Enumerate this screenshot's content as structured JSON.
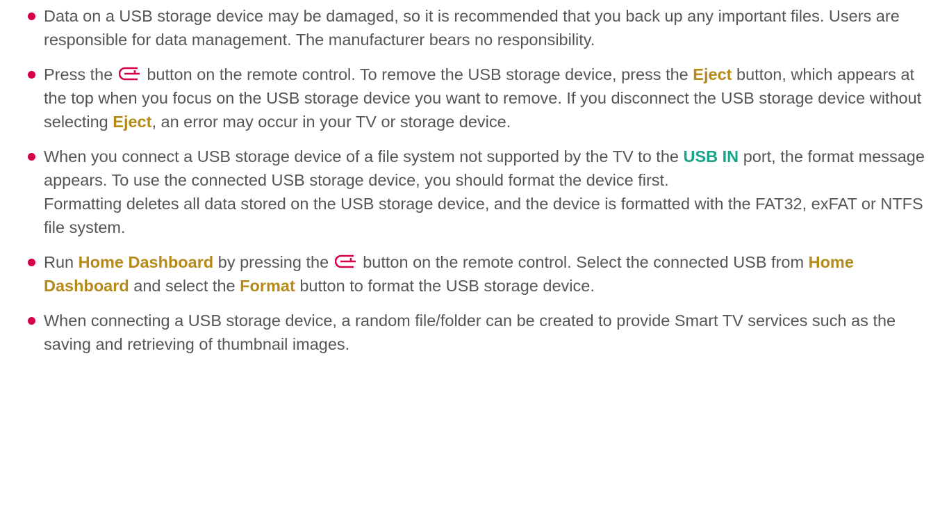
{
  "items": [
    {
      "text": "Data on a USB storage device may be damaged, so it is recommended that you back up any important files. Users are responsible for data management. The manufacturer bears no responsibility."
    },
    {
      "t1": "Press the",
      "t2": "button on the remote control. To remove the USB storage device, press the",
      "eject1": "Eject",
      "t3": "button, which appears at the top when you focus on the USB storage device you want to remove. If you disconnect the USB storage device without selecting",
      "eject2": "Eject",
      "t4": ", an error may occur in your TV or storage device."
    },
    {
      "t1": "When you connect a USB storage device of a file system not supported by the TV to the",
      "usb_in": "USB IN",
      "t2": "port, the format message appears. To use the connected USB storage device, you should format the device first.",
      "t3": "Formatting deletes all data stored on the USB storage device, and the device is formatted with the FAT32, exFAT or NTFS file system."
    },
    {
      "t1": "Run",
      "home1": "Home Dashboard",
      "t2": "by pressing the",
      "t3": "button on the remote control. Select the connected USB from",
      "home2": "Home Dashboard",
      "t4": "and select the",
      "format": "Format",
      "t5": "button to format the USB storage device."
    },
    {
      "text": "When connecting a USB storage device, a random file/folder can be created to provide Smart TV services such as the saving and retrieving of thumbnail images."
    }
  ],
  "colors": {
    "bullet": "#d6004c",
    "highlight_gold": "#b58a1a",
    "highlight_teal": "#1aa38a",
    "icon": "#d6004c",
    "body_text": "#555555"
  },
  "icons": {
    "remote_button": "input-button-icon"
  }
}
